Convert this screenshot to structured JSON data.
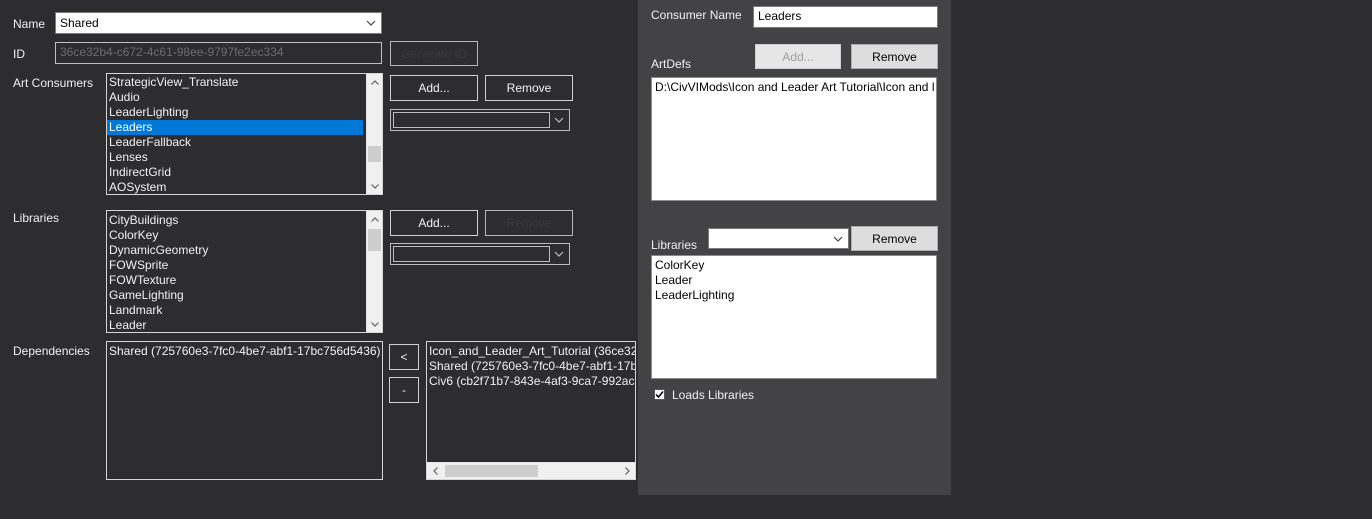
{
  "form": {
    "name_label": "Name",
    "name_value": "Shared",
    "id_label": "ID",
    "id_value": "36ce32b4-c672-4c61-98ee-9797fe2ec334",
    "generate_id_label": "Generate ID",
    "art_consumers_label": "Art Consumers",
    "art_consumers": [
      "StrategicView_Translate",
      "Audio",
      "LeaderLighting",
      "Leaders",
      "LeaderFallback",
      "Lenses",
      "IndirectGrid",
      "AOSystem"
    ],
    "art_consumers_selected": "Leaders",
    "consumers_add_label": "Add...",
    "consumers_remove_label": "Remove",
    "libraries_label": "Libraries",
    "libraries": [
      "CityBuildings",
      "ColorKey",
      "DynamicGeometry",
      "FOWSprite",
      "FOWTexture",
      "GameLighting",
      "Landmark",
      "Leader"
    ],
    "libraries_add_label": "Add...",
    "libraries_remove_label": "Remove",
    "dependencies_label": "Dependencies",
    "dependencies": [
      "Shared (725760e3-7fc0-4be7-abf1-17bc756d5436)"
    ],
    "move_left_label": "<",
    "move_right_label": "-",
    "available_dependencies": [
      "Icon_and_Leader_Art_Tutorial (36ce32b",
      "Shared (725760e3-7fc0-4be7-abf1-17bc",
      "Civ6 (cb2f71b7-843e-4af3-9ca7-992acc"
    ]
  },
  "consumer_panel": {
    "consumer_name_label": "Consumer Name",
    "consumer_name_value": "Leaders",
    "artdefs_label": "ArtDefs",
    "add_label": "Add...",
    "remove_label": "Remove",
    "artdefs": [
      "D:\\CivVIMods\\Icon and Leader Art Tutorial\\Icon and l"
    ],
    "libraries_label": "Libraries",
    "libraries_remove_label": "Remove",
    "libraries": [
      "ColorKey",
      "Leader",
      "LeaderLighting"
    ],
    "loads_libraries_label": "Loads Libraries",
    "loads_libraries_checked": true
  },
  "icons": {
    "dropdown": "chevron-down-icon",
    "scroll_up": "scroll-up-icon",
    "scroll_down": "scroll-down-icon",
    "scroll_left": "scroll-left-icon",
    "scroll_right": "scroll-right-icon",
    "check": "checkmark-icon"
  },
  "colors": {
    "background": "#2d2d30",
    "panel": "#434346",
    "selection": "#0078d7"
  }
}
